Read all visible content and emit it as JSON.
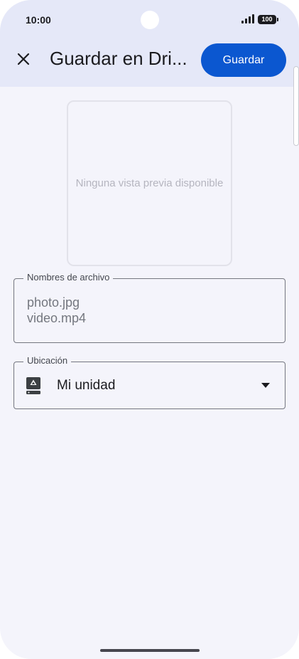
{
  "status_bar": {
    "time": "10:00",
    "battery": "100"
  },
  "toolbar": {
    "title": "Guardar en Dri...",
    "save_label": "Guardar",
    "accent_color": "#0b57d0"
  },
  "preview": {
    "placeholder_text": "Ninguna vista previa disponible"
  },
  "file_names": {
    "label": "Nombres de archivo",
    "items": [
      "photo.jpg",
      "video.mp4"
    ]
  },
  "location": {
    "label": "Ubicación",
    "value": "Mi unidad",
    "icon": "drive-icon"
  }
}
